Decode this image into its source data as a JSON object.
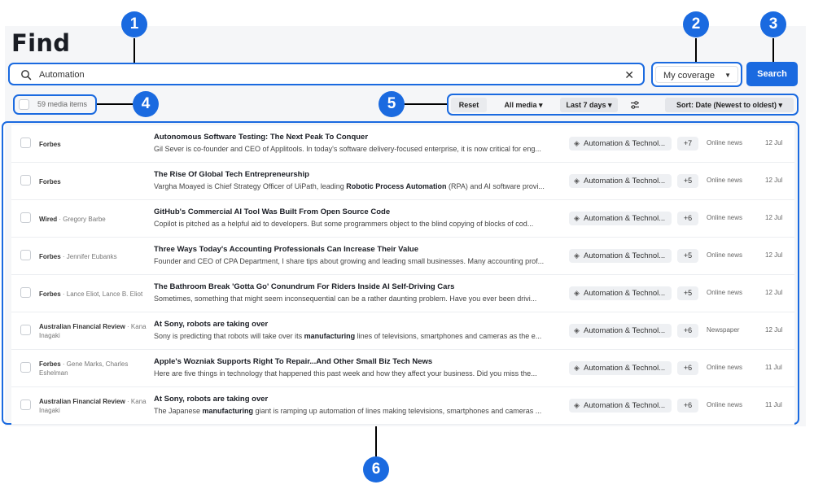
{
  "page": {
    "title": "Find"
  },
  "search": {
    "value": "Automation",
    "button_label": "Search"
  },
  "coverage": {
    "label": "My coverage"
  },
  "results": {
    "count_label": "59 media items"
  },
  "filters": {
    "reset_label": "Reset",
    "media_label": "All media ▾",
    "date_label": "Last 7 days ▾",
    "sort_label": "Sort: Date (Newest to oldest) ▾"
  },
  "markers": [
    "1",
    "2",
    "3",
    "4",
    "5",
    "6"
  ],
  "colors": {
    "accent": "#1a6ae0",
    "panel": "#f5f6f8"
  },
  "rows": [
    {
      "source": "Forbes",
      "author": "",
      "headline": "Autonomous Software Testing: The Next Peak To Conquer",
      "summary": [
        "Gil Sever is co-founder and CEO of Applitools. In today's software delivery-focused enterprise, it is now critical for eng..."
      ],
      "tag": "Automation & Technol...",
      "extra": "+7",
      "type": "Online news",
      "date": "12 Jul"
    },
    {
      "source": "Forbes",
      "author": "",
      "headline": "The Rise Of Global Tech Entrepreneurship",
      "summary": [
        "Vargha Moayed is Chief Strategy Officer of UiPath, leading ",
        "Robotic Process Automation",
        " (RPA) and AI software provi..."
      ],
      "tag": "Automation & Technol...",
      "extra": "+5",
      "type": "Online news",
      "date": "12 Jul"
    },
    {
      "source": "Wired",
      "author": " · Gregory Barbe",
      "headline": "GitHub's Commercial AI Tool Was Built From Open Source Code",
      "summary": [
        "Copilot is pitched as a helpful aid to developers. But some programmers object to the blind copying of blocks of cod..."
      ],
      "tag": "Automation & Technol...",
      "extra": "+6",
      "type": "Online news",
      "date": "12 Jul"
    },
    {
      "source": "Forbes",
      "author": " · Jennifer Eubanks",
      "headline": "Three Ways Today's Accounting Professionals Can Increase Their Value",
      "summary": [
        "Founder and CEO of CPA Department, I share tips about growing and leading small businesses. Many accounting prof..."
      ],
      "tag": "Automation & Technol...",
      "extra": "+5",
      "type": "Online news",
      "date": "12 Jul"
    },
    {
      "source": "Forbes",
      "author": " · Lance Eliot, Lance B. Eliot",
      "headline": "The Bathroom Break 'Gotta Go' Conundrum For Riders Inside AI Self-Driving Cars",
      "summary": [
        "Sometimes, something that might seem inconsequential can be a rather daunting problem. Have you ever been drivi..."
      ],
      "tag": "Automation & Technol...",
      "extra": "+5",
      "type": "Online news",
      "date": "12 Jul"
    },
    {
      "source": "Australian Financial Review",
      "author": " · Kana Inagaki",
      "headline": "At Sony, robots are taking over",
      "summary": [
        "Sony is predicting that robots will take over its ",
        "manufacturing",
        " lines of televisions, smartphones and cameras as the e..."
      ],
      "tag": "Automation & Technol...",
      "extra": "+6",
      "type": "Newspaper",
      "date": "12 Jul"
    },
    {
      "source": "Forbes",
      "author": " · Gene Marks, Charles Eshelman",
      "headline": "Apple's Wozniak Supports Right To Repair...And Other Small Biz Tech News",
      "summary": [
        "Here are five things in technology that happened this past week and how they affect your business. Did you miss the..."
      ],
      "tag": "Automation & Technol...",
      "extra": "+6",
      "type": "Online news",
      "date": "11 Jul"
    },
    {
      "source": "Australian Financial Review",
      "author": " · Kana Inagaki",
      "headline": "At Sony, robots are taking over",
      "summary": [
        "The Japanese ",
        "manufacturing",
        " giant is ramping up automation of lines making televisions, smartphones and cameras ..."
      ],
      "tag": "Automation & Technol...",
      "extra": "+6",
      "type": "Online news",
      "date": "11 Jul"
    }
  ]
}
